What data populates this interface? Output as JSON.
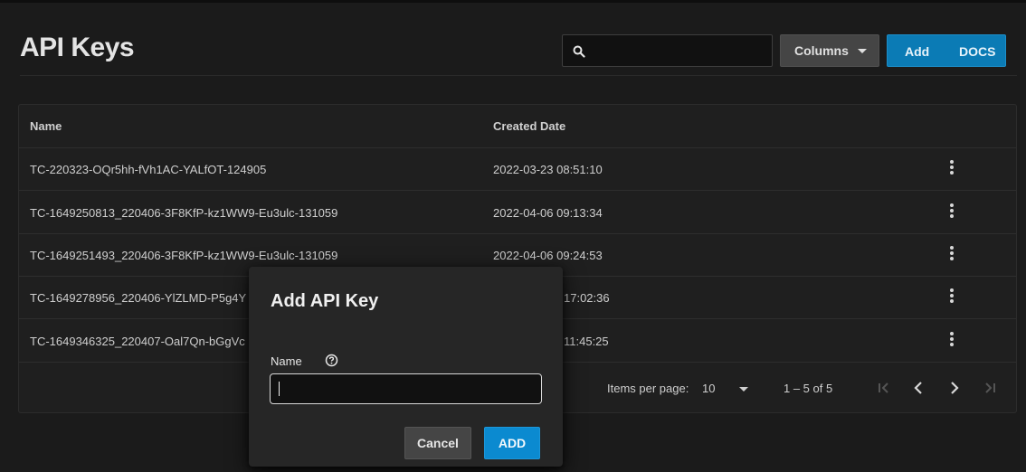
{
  "page": {
    "title": "API Keys"
  },
  "toolbar": {
    "search_placeholder": "",
    "columns_label": "Columns",
    "add_label": "Add",
    "docs_label": "DOCS"
  },
  "table": {
    "headers": {
      "name": "Name",
      "created": "Created Date"
    },
    "rows": [
      {
        "name": "TC-220323-OQr5hh-fVh1AC-YALfOT-124905",
        "created": "2022-03-23 08:51:10"
      },
      {
        "name": "TC-1649250813_220406-3F8KfP-kz1WW9-Eu3ulc-131059",
        "created": "2022-04-06 09:13:34"
      },
      {
        "name": "TC-1649251493_220406-3F8KfP-kz1WW9-Eu3ulc-131059",
        "created": "2022-04-06 09:24:53"
      },
      {
        "name": "TC-1649278956_220406-YlZLMD-P5g4Y",
        "created": "17:02:36"
      },
      {
        "name": "TC-1649346325_220407-Oal7Qn-bGgVc",
        "created": "11:45:25"
      }
    ]
  },
  "paginator": {
    "items_per_page_label": "Items per page:",
    "items_per_page_value": "10",
    "range_label": "1 – 5 of 5"
  },
  "dialog": {
    "title": "Add API Key",
    "name_label": "Name",
    "name_value": "",
    "cancel_label": "Cancel",
    "add_label": "ADD"
  },
  "colors": {
    "background": "#1b1b1b",
    "primary": "#0b7bb5",
    "dialog_primary": "#0b8ad0",
    "secondary_button": "#454545"
  }
}
